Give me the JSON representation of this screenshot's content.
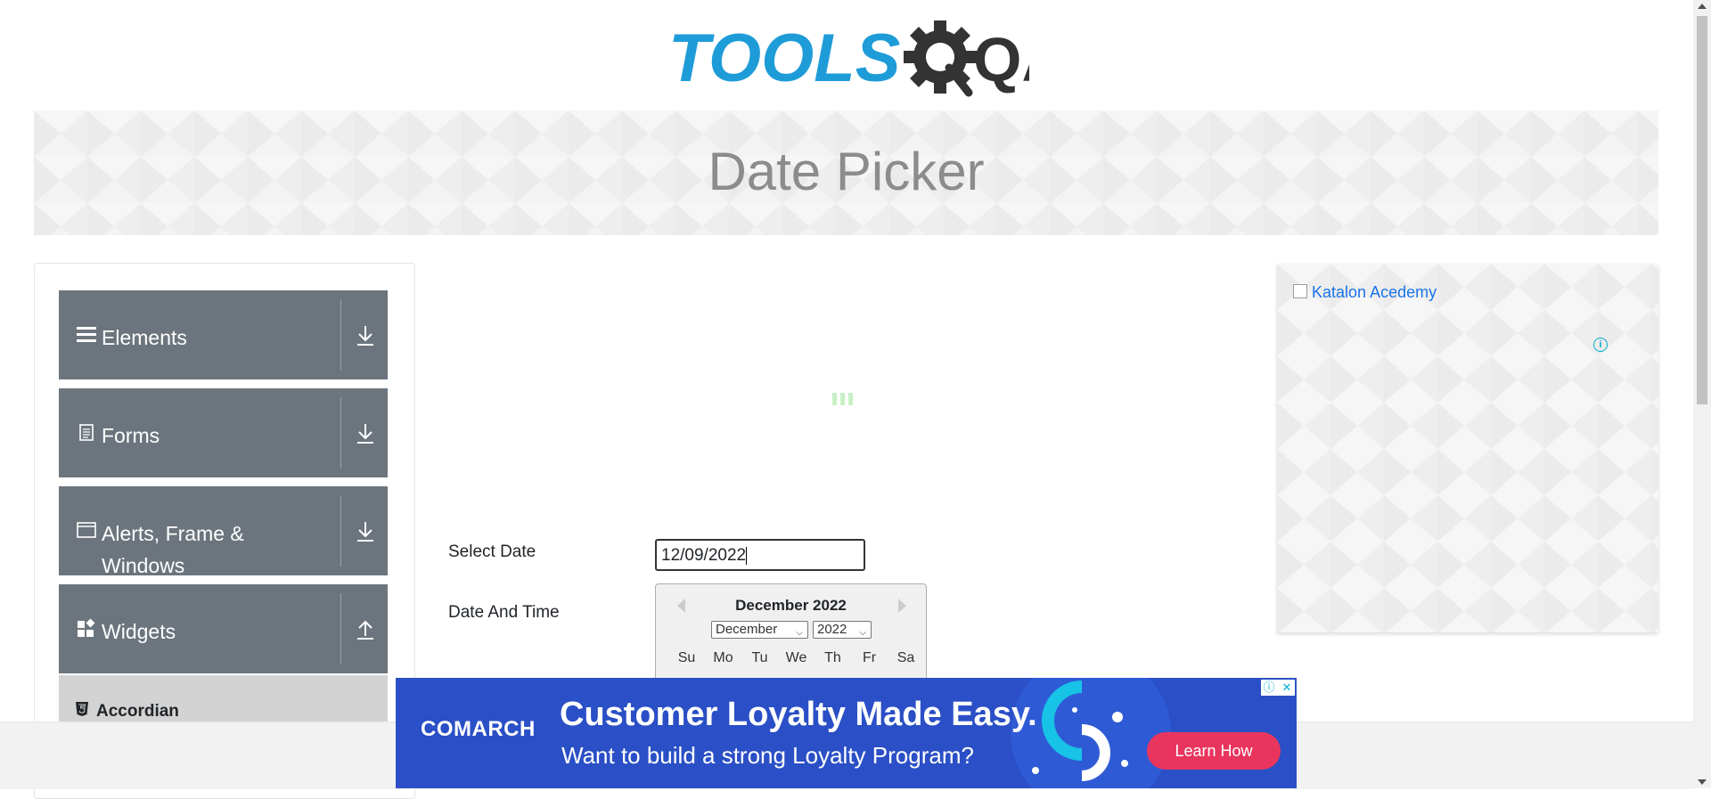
{
  "header": {
    "logo_text": "TOOLS",
    "logo_accent": "QA",
    "logo_color": "#1e9cd8",
    "logo_dark": "#333333"
  },
  "banner": {
    "title": "Date Picker"
  },
  "sidebar": {
    "groups": [
      {
        "label": "Elements",
        "icon": "hamburger-icon",
        "toggle_icon": "download-arrow-icon"
      },
      {
        "label": "Forms",
        "icon": "document-icon",
        "toggle_icon": "download-arrow-icon"
      },
      {
        "label": "Alerts, Frame &",
        "label2": "Windows",
        "icon": "window-icon",
        "toggle_icon": "download-arrow-icon"
      },
      {
        "label": "Widgets",
        "icon": "widgets-icon",
        "toggle_icon": "upload-arrow-icon"
      }
    ],
    "sub_items": [
      {
        "label": "Accordian",
        "icon": "html5-icon"
      }
    ]
  },
  "form": {
    "select_date_label": "Select Date",
    "select_date_value": "12/09/2022",
    "date_time_label": "Date And Time"
  },
  "datepicker": {
    "month_year": "December 2022",
    "month_select": "December",
    "year_select": "2022",
    "weekdays": [
      "Su",
      "Mo",
      "Tu",
      "We",
      "Th",
      "Fr",
      "Sa"
    ]
  },
  "side_ad": {
    "alt_text": "Katalon Acedemy"
  },
  "bottom_ad": {
    "brand": "COMARCH",
    "headline": "Customer Loyalty Made Easy.",
    "subline": "Want to build a strong Loyalty Program?",
    "cta": "Learn How",
    "bg_color": "#2a4fc6",
    "cta_color": "#e9355e"
  },
  "colors": {
    "sidebar_group": "#6c757d",
    "sub_item": "#d3d3d3",
    "banner": "#f3f3f3"
  }
}
